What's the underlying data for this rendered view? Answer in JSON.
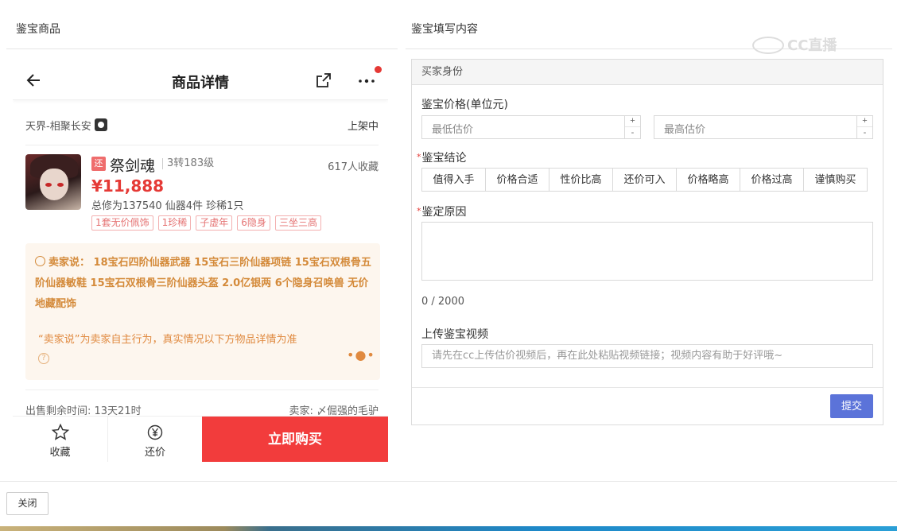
{
  "left_panel": {
    "header": "鉴宝商品",
    "title": "商品详情",
    "server": "天界-相聚长安",
    "status": "上架中",
    "bargain_badge": "还",
    "character_name": "祭剑魂",
    "level": "3转183级",
    "favorites": "617人收藏",
    "price": "¥11,888",
    "stats": "总修为137540  仙器4件  珍稀1只",
    "tags": [
      "1套无价佩饰",
      "1珍稀",
      "子虚年",
      "6隐身",
      "三坐三高"
    ],
    "seller_says": "卖家说：  18宝石四阶仙器武器 15宝石三阶仙器项链 15宝石双根骨五阶仙器敏鞋 15宝石双根骨三阶仙器头盔 2.0亿银两 6个隐身召唤兽 无价地藏配饰",
    "disclaimer": "“卖家说”为卖家自主行为，真实情况以下方物品详情为准",
    "remaining_time": "出售剩余时间: 13天21时",
    "seller": "卖家: 〆倔强的毛驴",
    "bottom": {
      "favorite": "收藏",
      "bargain": "还价",
      "buy": "立即购买"
    },
    "icons": [
      "arrow-left-icon",
      "share-icon",
      "more-icon",
      "apple-icon",
      "star-icon",
      "yen-icon",
      "help-icon"
    ]
  },
  "right_panel": {
    "header": "鉴宝填写内容",
    "watermark": "CC直播",
    "section_title": "买家身份",
    "price_label": "鉴宝价格(单位元)",
    "min_placeholder": "最低估价",
    "max_placeholder": "最高估价",
    "spin_up": "+",
    "spin_down": "-",
    "conclusion_label": "鉴宝结论",
    "verdicts": [
      "值得入手",
      "价格合适",
      "性价比高",
      "还价可入",
      "价格略高",
      "价格过高",
      "谨慎购买"
    ],
    "reason_label": "鉴定原因",
    "char_count": "0 / 2000",
    "video_label": "上传鉴宝视频",
    "video_placeholder": "请先在cc上传估价视频后，再在此处粘贴视频链接；视频内容有助于好评哦~",
    "submit": "提交",
    "required_mark": "*"
  },
  "footer": {
    "close": "关闭"
  },
  "colors": {
    "accent_red": "#f23c3c",
    "price_red": "#e53935",
    "submit_blue": "#5b73d9",
    "seller_orange": "#d48a3a"
  }
}
